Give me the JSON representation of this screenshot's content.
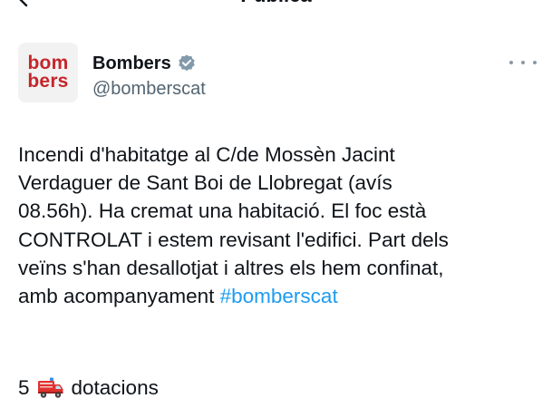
{
  "header": {
    "title": "Publica"
  },
  "author": {
    "avatar_line1": "bom",
    "avatar_line2": "bers",
    "name": "Bombers",
    "handle": "@bomberscat",
    "verified_icon": "verified-badge-icon"
  },
  "tweet": {
    "lines": [
      "Incendi d'habitatge al C/de Mossèn Jacint",
      "Verdaguer de Sant Boi de Llobregat (avís",
      "08.56h). Ha cremat una habitació. El foc està",
      "CONTROLAT i estem revisant l'edifici. Part dels",
      "veïns s'han desallotjat i altres els hem confinat,",
      "amb acompanyament "
    ],
    "hashtag": "#bomberscat",
    "stats_count": "5",
    "stats_icon": "fire-engine-icon",
    "stats_label": "dotacions"
  },
  "colors": {
    "text": "#0f1419",
    "secondary": "#536471",
    "link": "#1d9bf0",
    "brand_red": "#c4262b",
    "verified": "#829aab"
  }
}
